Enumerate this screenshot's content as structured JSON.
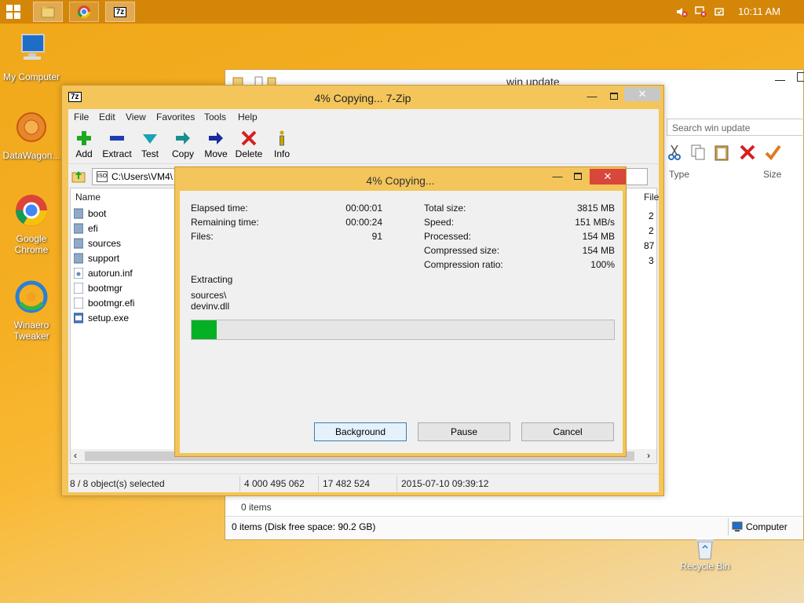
{
  "taskbar": {
    "clock": "10:11 AM",
    "apps": [
      {
        "name": "file-explorer"
      },
      {
        "name": "google-chrome"
      },
      {
        "name": "7-zip"
      }
    ]
  },
  "desktop": {
    "icons": [
      {
        "label": "My Computer"
      },
      {
        "label": "DataWagon..."
      },
      {
        "label": "Google Chrome"
      },
      {
        "label": "Winaero Tweaker"
      }
    ],
    "recycle_bin": "Recycle Bin"
  },
  "explorer": {
    "title": "win update",
    "search_placeholder": "Search win update",
    "col_type": "Type",
    "col_size": "Size",
    "items_count": "0 items",
    "status": "0 items (Disk free space: 90.2 GB)",
    "location": "Computer"
  },
  "zip": {
    "title": "4% Copying... 7-Zip",
    "logo": "7z",
    "menu": [
      "File",
      "Edit",
      "View",
      "Favorites",
      "Tools",
      "Help"
    ],
    "tools": [
      {
        "label": "Add",
        "icon": "plus-icon",
        "color": "#1fa81f"
      },
      {
        "label": "Extract",
        "icon": "minus-icon",
        "color": "#1a3fb5"
      },
      {
        "label": "Test",
        "icon": "checkmark-icon",
        "color": "#19a3b3"
      },
      {
        "label": "Copy",
        "icon": "copy-arrow-icon",
        "color": "#1a8f8f"
      },
      {
        "label": "Move",
        "icon": "move-arrow-icon",
        "color": "#1a2a9f"
      },
      {
        "label": "Delete",
        "icon": "x-icon",
        "color": "#d62020"
      },
      {
        "label": "Info",
        "icon": "info-icon",
        "color": "#c9a600"
      }
    ],
    "address": "C:\\Users\\VM4\\",
    "col_name": "Name",
    "col_file": "File",
    "files": [
      {
        "name": "boot",
        "kind": "folder"
      },
      {
        "name": "efi",
        "kind": "folder"
      },
      {
        "name": "sources",
        "kind": "folder"
      },
      {
        "name": "support",
        "kind": "folder"
      },
      {
        "name": "autorun.inf",
        "kind": "file"
      },
      {
        "name": "bootmgr",
        "kind": "file"
      },
      {
        "name": "bootmgr.efi",
        "kind": "file"
      },
      {
        "name": "setup.exe",
        "kind": "exe"
      }
    ],
    "file_col_values": [
      "2",
      "2",
      "87",
      "3"
    ],
    "status": {
      "selected": "8 / 8 object(s) selected",
      "size": "4 000 495 062",
      "packed": "17 482 524",
      "modified": "2015-07-10 09:39:12"
    }
  },
  "progress": {
    "title": "4% Copying...",
    "elapsed_label": "Elapsed time:",
    "elapsed": "00:00:01",
    "remaining_label": "Remaining time:",
    "remaining": "00:00:24",
    "files_label": "Files:",
    "files": "91",
    "total_size_label": "Total size:",
    "total_size": "3815 MB",
    "speed_label": "Speed:",
    "speed": "151 MB/s",
    "processed_label": "Processed:",
    "processed": "154 MB",
    "compressed_label": "Compressed size:",
    "compressed": "154 MB",
    "ratio_label": "Compression ratio:",
    "ratio": "100%",
    "operation": "Extracting",
    "current_path": "sources\\",
    "current_file": "devinv.dll",
    "percent": 0.06,
    "buttons": {
      "background": "Background",
      "pause": "Pause",
      "cancel": "Cancel"
    }
  }
}
